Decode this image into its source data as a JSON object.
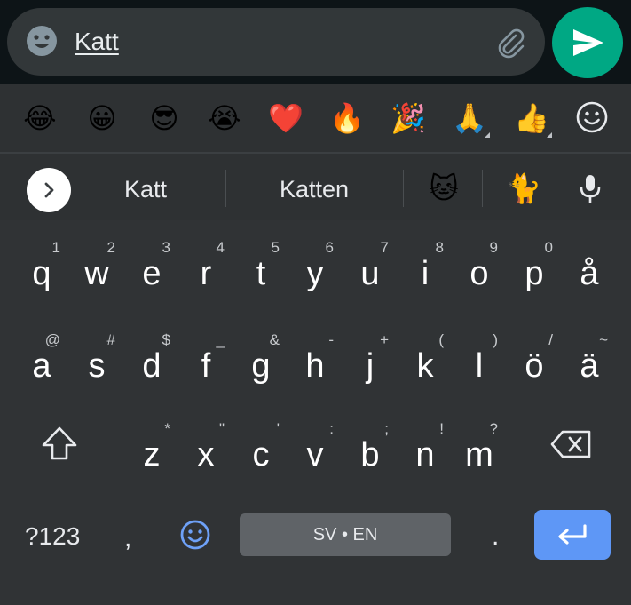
{
  "compose": {
    "message_text": "Katt",
    "icons": {
      "emoji": "smiley-icon",
      "attach": "paperclip-icon",
      "send": "send-arrow-icon"
    },
    "accent_color": "#00a884"
  },
  "emoji_strip": {
    "items": [
      "😂",
      "😀",
      "😎",
      "😭",
      "❤️",
      "🔥",
      "🎉",
      "🙏",
      "👍"
    ],
    "more_icon": "emoji-smiley-outline-icon"
  },
  "suggestions": {
    "expand_icon": "chevron-right-icon",
    "words": [
      "Katt",
      "Katten"
    ],
    "emojis": [
      "🐱",
      "🐈"
    ],
    "mic_icon": "microphone-icon"
  },
  "keyboard": {
    "row1": [
      {
        "main": "q",
        "hint": "1"
      },
      {
        "main": "w",
        "hint": "2"
      },
      {
        "main": "e",
        "hint": "3"
      },
      {
        "main": "r",
        "hint": "4"
      },
      {
        "main": "t",
        "hint": "5"
      },
      {
        "main": "y",
        "hint": "6"
      },
      {
        "main": "u",
        "hint": "7"
      },
      {
        "main": "i",
        "hint": "8"
      },
      {
        "main": "o",
        "hint": "9"
      },
      {
        "main": "p",
        "hint": "0"
      },
      {
        "main": "å",
        "hint": ""
      }
    ],
    "row2": [
      {
        "main": "a",
        "hint": "@"
      },
      {
        "main": "s",
        "hint": "#"
      },
      {
        "main": "d",
        "hint": "$"
      },
      {
        "main": "f",
        "hint": "_"
      },
      {
        "main": "g",
        "hint": "&"
      },
      {
        "main": "h",
        "hint": "-"
      },
      {
        "main": "j",
        "hint": "+"
      },
      {
        "main": "k",
        "hint": "("
      },
      {
        "main": "l",
        "hint": ")"
      },
      {
        "main": "ö",
        "hint": "/"
      },
      {
        "main": "ä",
        "hint": "~"
      }
    ],
    "row3": [
      {
        "main": "z",
        "hint": "*"
      },
      {
        "main": "x",
        "hint": "\""
      },
      {
        "main": "c",
        "hint": "'"
      },
      {
        "main": "v",
        "hint": ":"
      },
      {
        "main": "b",
        "hint": ";"
      },
      {
        "main": "n",
        "hint": "!"
      },
      {
        "main": "m",
        "hint": "?"
      }
    ],
    "shift_icon": "shift-arrow-icon",
    "backspace_icon": "backspace-icon",
    "symbols_label": "?123",
    "comma": ",",
    "emoji_key_icon": "smiley-icon",
    "space_label": "SV • EN",
    "period": ".",
    "enter_icon": "enter-return-icon",
    "enter_color": "#5e97f6"
  }
}
